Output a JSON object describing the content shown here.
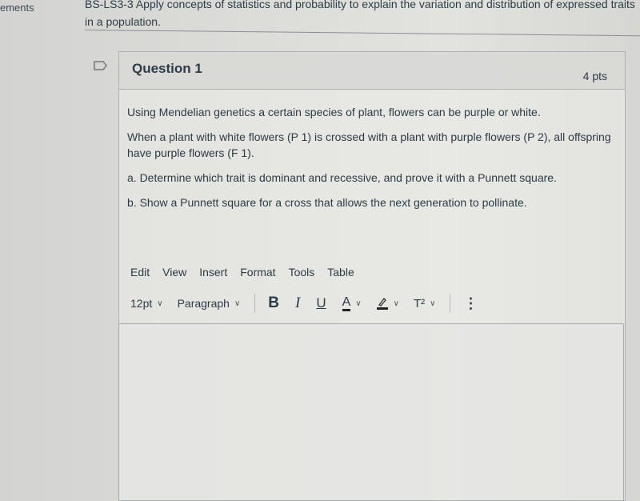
{
  "sidebar": {
    "partial_item": "ements"
  },
  "outcome": {
    "line1": "BS-LS3-3 Apply concepts of statistics and probability to explain the variation and distribution of expressed traits",
    "line2": "in a population."
  },
  "question": {
    "title": "Question 1",
    "points": "4 pts",
    "paragraphs": [
      "Using Mendelian genetics a certain species of plant, flowers can be purple or white.",
      "When a plant with white flowers (P 1) is crossed with a plant with purple flowers (P 2), all offspring have purple flowers (F 1).",
      "a. Determine which trait is dominant and recessive, and prove it with a Punnett square.",
      "b. Show a Punnett square for a cross that allows the next generation to pollinate."
    ]
  },
  "editor": {
    "menu": [
      "Edit",
      "View",
      "Insert",
      "Format",
      "Tools",
      "Table"
    ],
    "font_size": "12pt",
    "block_format": "Paragraph",
    "bold": "B",
    "italic": "I",
    "underline": "U",
    "text_color": "A",
    "superscript": "T²",
    "more": "⋮",
    "content": ""
  }
}
